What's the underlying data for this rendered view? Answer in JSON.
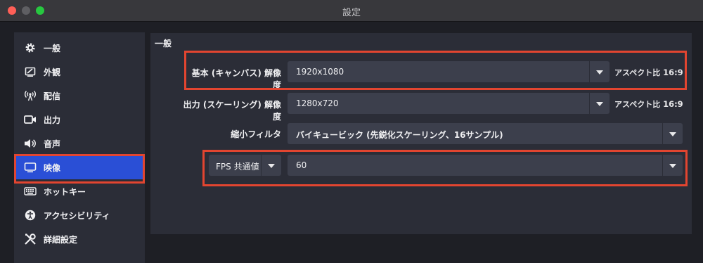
{
  "window": {
    "title": "設定"
  },
  "sidebar": {
    "items": [
      {
        "label": "一般",
        "icon": "gear-icon",
        "active": false
      },
      {
        "label": "外観",
        "icon": "appearance-icon",
        "active": false
      },
      {
        "label": "配信",
        "icon": "broadcast-icon",
        "active": false
      },
      {
        "label": "出力",
        "icon": "output-icon",
        "active": false
      },
      {
        "label": "音声",
        "icon": "speaker-icon",
        "active": false
      },
      {
        "label": "映像",
        "icon": "monitor-icon",
        "active": true
      },
      {
        "label": "ホットキー",
        "icon": "keyboard-icon",
        "active": false
      },
      {
        "label": "アクセシビリティ",
        "icon": "accessibility-icon",
        "active": false
      },
      {
        "label": "詳細設定",
        "icon": "tools-icon",
        "active": false
      }
    ]
  },
  "main": {
    "section_title": "一般",
    "base_resolution": {
      "label": "基本 (キャンバス) 解像度",
      "value": "1920x1080",
      "aspect_prefix": "アスペクト比",
      "aspect_value": "16:9"
    },
    "output_resolution": {
      "label": "出力 (スケーリング) 解像度",
      "value": "1280x720",
      "aspect_prefix": "アスペクト比",
      "aspect_value": "16:9"
    },
    "downscale_filter": {
      "label": "縮小フィルタ",
      "value": "バイキュービック (先鋭化スケーリング、16サンプル)"
    },
    "fps": {
      "type_value": "FPS 共通値",
      "value": "60"
    }
  },
  "colors": {
    "accent_active": "#2a4fd6",
    "highlight_border": "#e24530",
    "panel": "#2b2d37",
    "combo": "#3c3f4c"
  }
}
